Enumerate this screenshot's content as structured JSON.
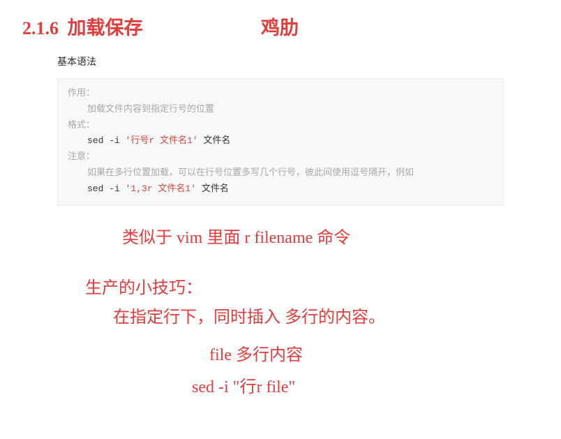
{
  "heading": {
    "number": "2.1.6",
    "title": "加载保存",
    "annotation": "鸡肋"
  },
  "subheading": "基本语法",
  "codebox": {
    "line1_label": "作用：",
    "line1_desc": "加载文件内容到指定行号的位置",
    "line2_label": "格式：",
    "line2_code_pre": "sed -i ",
    "line2_code_str": "'行号r 文件名1'",
    "line2_code_post": " 文件名",
    "line3_label": "注意：",
    "line3_desc": "如果在多行位置加载，可以在行号位置多写几个行号，彼此间使用逗号隔开，例如",
    "line3_code_pre": "sed -i ",
    "line3_code_str": "'1,3r 文件名1'",
    "line3_code_post": " 文件名"
  },
  "annotations": {
    "a1": "类似于   vim 里面   r filename 命令",
    "a2": "生产的小技巧：",
    "a3": "在指定行下，同时插入 多行的内容。",
    "a4": "file  多行内容",
    "a5": "sed -i \"行r file\""
  }
}
